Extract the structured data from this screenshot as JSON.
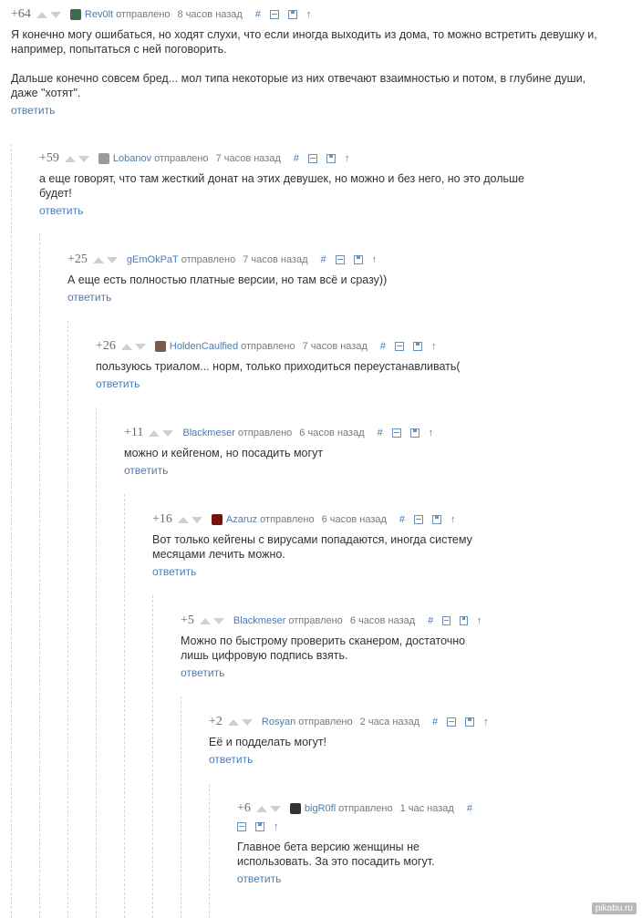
{
  "labels": {
    "sent": "отправлено",
    "reply": "ответить",
    "anchor": "#"
  },
  "comments": [
    {
      "rating": "+64",
      "author": "Rev0lt",
      "time": "8 часов назад",
      "avatar_color": "#3f6b4a",
      "text": [
        "Я конечно могу ошибаться, но ходят слухи, что если иногда выходить из дома, то можно встретить девушку и, например, попытаться с ней поговорить.",
        "Дальше конечно совсем бред... мол типа некоторые из них отвечают взаимностью и потом, в глубине души, даже \"хотят\"."
      ]
    },
    {
      "rating": "+59",
      "author": "Lobanov",
      "time": "7 часов назад",
      "avatar_color": "#9a9a9a",
      "text": [
        "а еще говорят, что там жесткий донат на этих девушек, но можно и без него, но это дольше будет!"
      ]
    },
    {
      "rating": "+25",
      "author": "gEmOkPaT",
      "time": "7 часов назад",
      "avatar_color": "",
      "text": [
        "А еще есть полностью платные версии, но там всё и сразу))"
      ]
    },
    {
      "rating": "+26",
      "author": "HoldenCaulfied",
      "time": "7 часов назад",
      "avatar_color": "#7a5a4a",
      "text": [
        "пользуюсь триалом... норм, только приходиться переустанавливать("
      ]
    },
    {
      "rating": "+11",
      "author": "Blackmeser",
      "time": "6 часов назад",
      "avatar_color": "",
      "text": [
        "можно и кейгеном, но посадить могут"
      ]
    },
    {
      "rating": "+16",
      "author": "Azaruz",
      "time": "6 часов назад",
      "avatar_color": "#7a1010",
      "text": [
        "Вот только кейгены с вирусами попадаются, иногда систему месяцами лечить можно."
      ]
    },
    {
      "rating": "+5",
      "author": "Blackmeser",
      "time": "6 часов назад",
      "avatar_color": "",
      "text": [
        "Можно по быстрому проверить сканером, достаточно лишь цифровую подпись взять."
      ]
    },
    {
      "rating": "+2",
      "author": "Rosyan",
      "time": "2 часа назад",
      "avatar_color": "",
      "text": [
        "Её и подделать могут!"
      ]
    },
    {
      "rating": "+6",
      "author": "bigR0fl",
      "time": "1 час назад",
      "avatar_color": "#333333",
      "text": [
        "Главное бета версию женщины не использовать. За это посадить могут."
      ]
    }
  ],
  "watermark": "pikabu.ru"
}
